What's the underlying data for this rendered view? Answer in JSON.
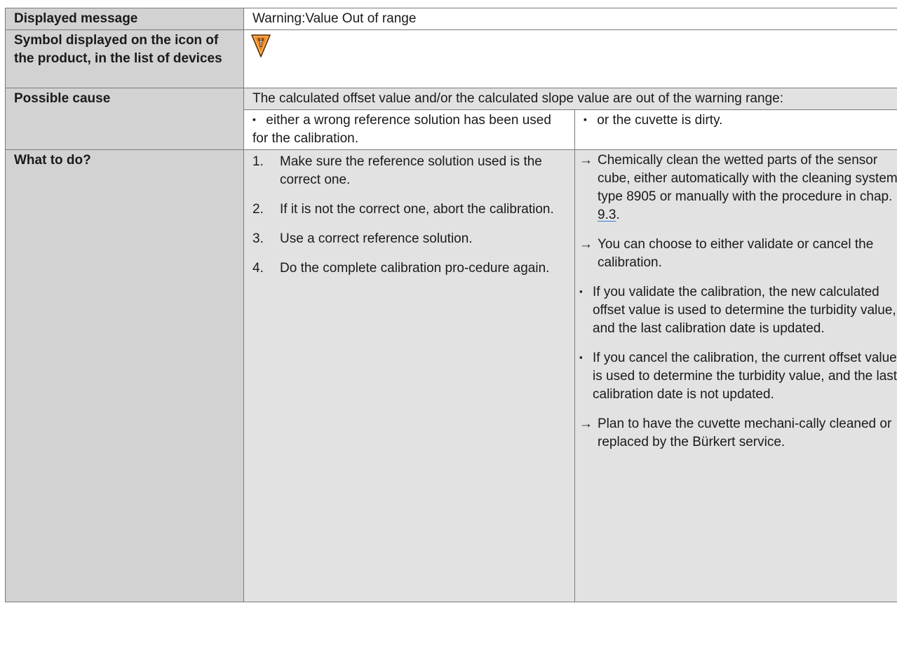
{
  "rows": {
    "message": {
      "label": "Displayed message",
      "value": "Warning:Value Out of range"
    },
    "symbol": {
      "label": "Symbol displayed on the icon of the product, in the list of devices",
      "icon": "wrench-warning-triangle-icon",
      "icon_color": "#f08a24"
    },
    "cause": {
      "label": "Possible cause",
      "text": "The calculated offset value and/or the calculated slope value are out of the warning range:",
      "left": "either a wrong reference solution has been used for the calibration.",
      "right": "or the cuvette is dirty."
    },
    "todo": {
      "label": "What to do?",
      "steps": [
        {
          "num": "1.",
          "text": "Make sure the reference solution used is the correct one."
        },
        {
          "num": "2.",
          "text": "If it is not the correct one, abort the calibration."
        },
        {
          "num": "3.",
          "text": "Use a correct reference solution."
        },
        {
          "num": "4.",
          "text": "Do the complete calibration pro-cedure again."
        }
      ],
      "actions": {
        "a1_prefix": "Chemically clean the wetted parts of the sensor cube, either automatically with the cleaning system type 8905 or manually with the procedure in chap. ",
        "a1_link": "9.3",
        "a1_suffix": ".",
        "a2": "You can choose to either validate or cancel the calibration.",
        "b1": "If you validate the calibration, the new calculated offset value is used to determine the turbidity value, and the last calibration date is updated.",
        "b2": "If you cancel the calibration, the current offset value is used to determine the turbidity value, and the last calibration date is not updated.",
        "a3": "Plan to have the cuvette mechani-cally cleaned or replaced by the Bürkert service."
      }
    }
  },
  "symbols": {
    "arrow": "→",
    "bullet": "▪"
  }
}
